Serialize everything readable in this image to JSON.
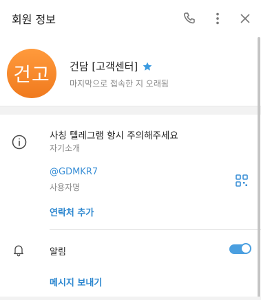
{
  "header": {
    "title": "회원 정보",
    "icons": [
      "phone-icon",
      "more-vertical-icon",
      "close-icon"
    ]
  },
  "profile": {
    "avatar_text": "건고",
    "avatar_color": "#f5872a",
    "name": "건담 [고객센터]",
    "verified_icon": "star-icon",
    "status": "마지막으로 접속한 지 오래됨"
  },
  "info": {
    "bio": "사칭 텔레그램 항시 주의해주세요",
    "bio_label": "자기소개",
    "username": "@GDMKR7",
    "username_label": "사용자명",
    "add_contact": "연락처 추가"
  },
  "notifications": {
    "label": "알림",
    "enabled": true
  },
  "actions": {
    "send_message": "메시지 보내기"
  },
  "colors": {
    "accent": "#2b86cf",
    "link": "#3a8fd6",
    "toggle_on": "#4a9fe0"
  }
}
